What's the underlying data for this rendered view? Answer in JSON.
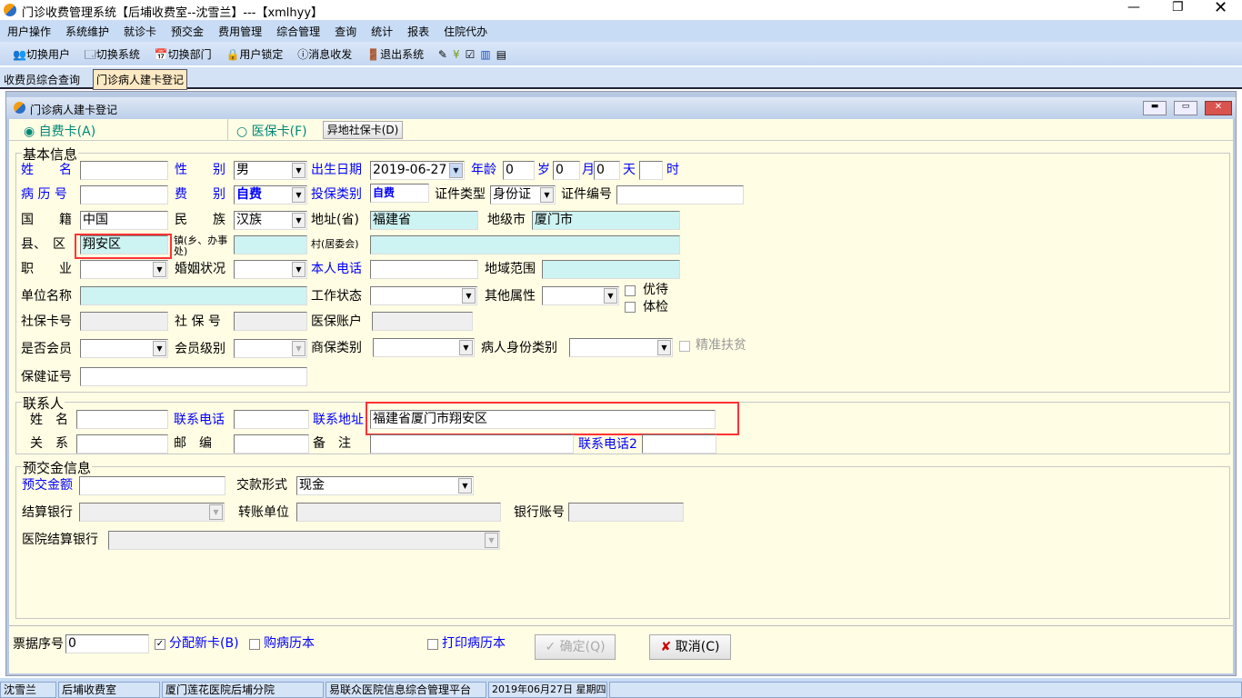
{
  "window": {
    "title": "门诊收费管理系统【后埔收费室--沈雪兰】---【xmlhyy】"
  },
  "menu": [
    "用户操作",
    "系统维护",
    "就诊卡",
    "预交金",
    "费用管理",
    "综合管理",
    "查询",
    "统计",
    "报表",
    "住院代办"
  ],
  "toolbar": [
    "切换用户",
    "切换系统",
    "切换部门",
    "用户锁定",
    "消息收发",
    "退出系统"
  ],
  "tabs": [
    "收费员综合查询",
    "门诊病人建卡登记"
  ],
  "inner": {
    "title": "门诊病人建卡登记"
  },
  "cardtype": {
    "self": "自费卡(A)",
    "insurance": "医保卡(F)",
    "remote": "异地社保卡(D)",
    "selected": "self"
  },
  "basic": {
    "legend": "基本信息",
    "name_l": "姓　　名",
    "name": "",
    "gender_l": "性　　别",
    "gender": "男",
    "birth_l": "出生日期",
    "birth": "2019-06-27",
    "age_l": "年龄",
    "age_y": "0",
    "y_l": "岁",
    "age_m": "0",
    "m_l": "月",
    "age_d": "0",
    "d_l": "天",
    "age_h": "",
    "h_l": "时",
    "record_l": "病 历 号",
    "record": "",
    "fee_l": "费　　别",
    "fee": "自费",
    "ins_l": "投保类别",
    "ins": "自费",
    "idtype_l": "证件类型",
    "idtype": "身份证",
    "idno_l": "证件编号",
    "idno": "",
    "nation_l": "国　　籍",
    "nation": "中国",
    "ethnic_l": "民　　族",
    "ethnic": "汉族",
    "prov_l": "地址(省)",
    "prov": "福建省",
    "city_l": "地级市",
    "city": "厦门市",
    "county_l": "县、　区",
    "county": "翔安区",
    "town_l": "镇(乡、办事处)",
    "town": "",
    "village_l": "村(居委会)",
    "village": "",
    "job_l": "职　　业",
    "job": "",
    "marital_l": "婚姻状况",
    "marital": "",
    "phone_l": "本人电话",
    "phone": "",
    "region_l": "地域范围",
    "region": "",
    "org_l": "单位名称",
    "org": "",
    "work_l": "工作状态",
    "work": "",
    "other_l": "其他属性",
    "other": "",
    "vip_l": "优待",
    "exam_l": "体检",
    "sscard_l": "社保卡号",
    "sscard": "",
    "ssno_l": "社 保 号",
    "ssno": "",
    "acct_l": "医保账户",
    "acct": "",
    "member_l": "是否会员",
    "member": "",
    "level_l": "会员级别",
    "level": "",
    "comm_l": "商保类别",
    "comm": "",
    "ptype_l": "病人身份类别",
    "ptype": "",
    "poverty_l": "精准扶贫",
    "health_l": "保健证号",
    "health": ""
  },
  "contact": {
    "legend": "联系人",
    "name_l": "姓　名",
    "name": "",
    "phone_l": "联系电话",
    "phone": "",
    "addr_l": "联系地址",
    "addr": "福建省厦门市翔安区",
    "rel_l": "关　系",
    "rel": "",
    "zip_l": "邮　编",
    "zip": "",
    "note_l": "备　注",
    "note": "",
    "phone2_l": "联系电话2",
    "phone2": ""
  },
  "deposit": {
    "legend": "预交金信息",
    "amount_l": "预交金额",
    "amount": "",
    "pay_l": "交款形式",
    "pay": "现金",
    "bank_l": "结算银行",
    "bank": "",
    "unit_l": "转账单位",
    "unit": "",
    "acct_l": "银行账号",
    "acct": "",
    "hbank_l": "医院结算银行",
    "hbank": ""
  },
  "bottom": {
    "ticket_l": "票据序号",
    "ticket": "0",
    "newcard": "分配新卡(B)",
    "newcard_checked": true,
    "buybook": "购病历本",
    "printbook": "打印病历本",
    "ok": "✓ 确定(Q)",
    "cancel": "取消(C)"
  },
  "status": [
    "沈雪兰",
    "后埔收费室",
    "厦门莲花医院后埔分院",
    "易联众医院信息综合管理平台",
    "2019年06月27日  星期四"
  ],
  "colors": {
    "label_blue": "#0000ff",
    "form_bg": "#fffde4",
    "readonly_cyan": "#cdf3f2",
    "highlight_red": "#ff3333"
  }
}
